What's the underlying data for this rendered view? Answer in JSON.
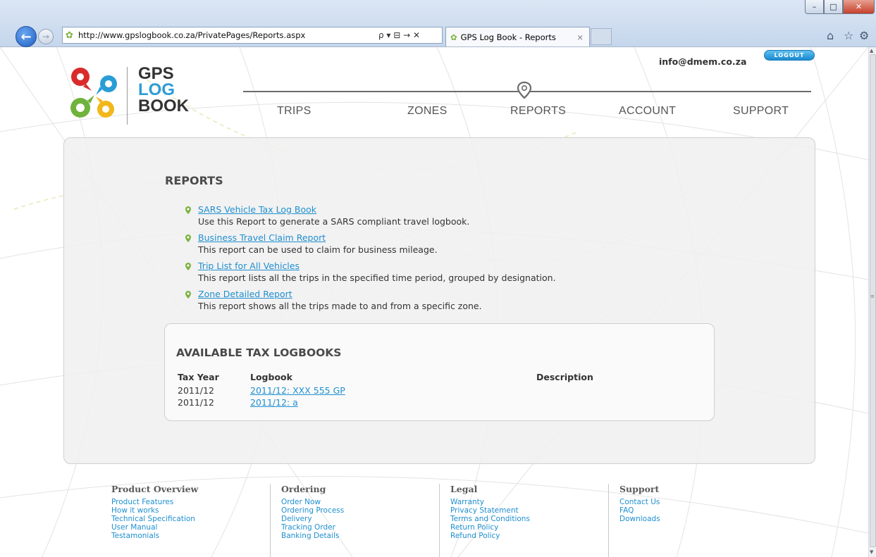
{
  "browser": {
    "url": "http://www.gpslogbook.co.za/PrivatePages/Reports.aspx",
    "tab_title": "GPS Log Book - Reports",
    "address_tools": "ρ ▾ ⊟ → ✕",
    "minimize": "–",
    "maximize": "□",
    "close": "✕",
    "tab_close": "×"
  },
  "header": {
    "logo_lines": [
      "GPS",
      "LOG",
      "BOOK"
    ],
    "user_email": "info@dmem.co.za",
    "logout_label": "LOGOUT"
  },
  "nav": {
    "items": [
      "TRIPS",
      "ZONES",
      "REPORTS",
      "ACCOUNT",
      "SUPPORT"
    ],
    "active": "REPORTS"
  },
  "reports": {
    "title": "REPORTS",
    "items": [
      {
        "link": "SARS Vehicle Tax Log Book",
        "desc": "Use this Report to generate a SARS compliant travel logbook."
      },
      {
        "link": "Business Travel Claim Report",
        "desc": "This report can be used to claim for business mileage."
      },
      {
        "link": "Trip List for All Vehicles",
        "desc": "This report lists all the trips in the specified time period, grouped by designation."
      },
      {
        "link": "Zone Detailed Report",
        "desc": "This report shows all the trips made to and from a specific zone."
      }
    ]
  },
  "tax_logbooks": {
    "title": "AVAILABLE TAX LOGBOOKS",
    "headers": [
      "Tax Year",
      "Logbook",
      "Description"
    ],
    "rows": [
      {
        "tax_year": "2011/12",
        "logbook": "2011/12: XXX 555 GP",
        "description": ""
      },
      {
        "tax_year": "2011/12",
        "logbook": "2011/12: a",
        "description": ""
      }
    ]
  },
  "footer": {
    "columns": [
      {
        "title": "Product Overview",
        "links": [
          "Product Features",
          "How it works",
          "Technical Specification",
          "User Manual",
          "Testamonials"
        ]
      },
      {
        "title": "Ordering",
        "links": [
          "Order Now",
          "Ordering Process",
          "Delivery",
          "Tracking Order",
          "Banking Details"
        ]
      },
      {
        "title": "Legal",
        "links": [
          "Warranty",
          "Privacy Statement",
          "Terms and Conditions",
          "Return Policy",
          "Refund Policy"
        ]
      },
      {
        "title": "Support",
        "links": [
          "Contact Us",
          "FAQ",
          "Downloads"
        ]
      }
    ]
  },
  "colors": {
    "link": "#1f8fd0",
    "pin_green": "#7cb342",
    "logo_red": "#d92b2b",
    "logo_blue": "#2a9dd6",
    "logo_green": "#6fb33c",
    "logo_yellow": "#f2b71a"
  }
}
